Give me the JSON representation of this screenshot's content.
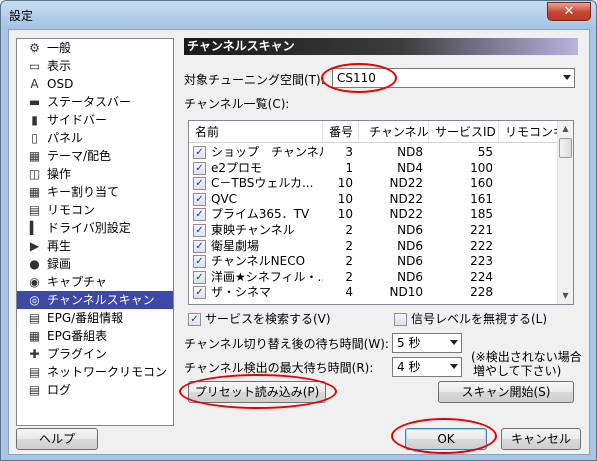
{
  "window": {
    "title": "設定",
    "close_glyph": "✕"
  },
  "sidebar": {
    "items": [
      {
        "label": "一般",
        "icon": "gear-icon",
        "glyph": "⚙"
      },
      {
        "label": "表示",
        "icon": "display-icon",
        "glyph": "▭"
      },
      {
        "label": "OSD",
        "icon": "osd-icon",
        "glyph": "A"
      },
      {
        "label": "ステータスバー",
        "icon": "statusbar-icon",
        "glyph": "▬"
      },
      {
        "label": "サイドバー",
        "icon": "sidebar-icon",
        "glyph": "▮"
      },
      {
        "label": "パネル",
        "icon": "panel-icon",
        "glyph": "▯"
      },
      {
        "label": "テーマ/配色",
        "icon": "theme-icon",
        "glyph": "▦"
      },
      {
        "label": "操作",
        "icon": "mouse-icon",
        "glyph": "◫"
      },
      {
        "label": "キー割り当て",
        "icon": "keyboard-icon",
        "glyph": "▦"
      },
      {
        "label": "リモコン",
        "icon": "remote-icon",
        "glyph": "▤"
      },
      {
        "label": "ドライバ別設定",
        "icon": "driver-icon",
        "glyph": "▍"
      },
      {
        "label": "再生",
        "icon": "play-icon",
        "glyph": "▶"
      },
      {
        "label": "録画",
        "icon": "record-icon",
        "glyph": "●"
      },
      {
        "label": "キャプチャ",
        "icon": "camera-icon",
        "glyph": "◉"
      },
      {
        "label": "チャンネルスキャン",
        "icon": "scan-icon",
        "glyph": "◎"
      },
      {
        "label": "EPG/番組情報",
        "icon": "epg-icon",
        "glyph": "▤"
      },
      {
        "label": "EPG番組表",
        "icon": "epg-table-icon",
        "glyph": "▦"
      },
      {
        "label": "プラグイン",
        "icon": "plugin-icon",
        "glyph": "✚"
      },
      {
        "label": "ネットワークリモコン",
        "icon": "network-remote-icon",
        "glyph": "▤"
      },
      {
        "label": "ログ",
        "icon": "log-icon",
        "glyph": "▤"
      }
    ],
    "selected_index": 14
  },
  "page": {
    "header": "チャンネルスキャン",
    "tuning_space_label": "対象チューニング空間(T):",
    "tuning_space_value": "CS110",
    "channel_list_label": "チャンネル一覧(C):",
    "columns": [
      "名前",
      "番号",
      "チャンネル",
      "サービスID",
      "リモコンキ"
    ],
    "rows": [
      {
        "name": "ショップ　チャンネル",
        "num": "3",
        "ch": "ND8",
        "sid": "55",
        "checked": true
      },
      {
        "name": "e2プロモ",
        "num": "1",
        "ch": "ND4",
        "sid": "100",
        "checked": true
      },
      {
        "name": "C－TBSウェルカ...",
        "num": "10",
        "ch": "ND22",
        "sid": "160",
        "checked": true
      },
      {
        "name": "QVC",
        "num": "10",
        "ch": "ND22",
        "sid": "161",
        "checked": true
      },
      {
        "name": "プライム365．TV",
        "num": "10",
        "ch": "ND22",
        "sid": "185",
        "checked": true
      },
      {
        "name": "東映チャンネル",
        "num": "2",
        "ch": "ND6",
        "sid": "221",
        "checked": true
      },
      {
        "name": "衛星劇場",
        "num": "2",
        "ch": "ND6",
        "sid": "222",
        "checked": true
      },
      {
        "name": "チャンネルNECO",
        "num": "2",
        "ch": "ND6",
        "sid": "223",
        "checked": true
      },
      {
        "name": "洋画★シネフィル・...",
        "num": "2",
        "ch": "ND6",
        "sid": "224",
        "checked": true
      },
      {
        "name": "ザ・シネマ",
        "num": "4",
        "ch": "ND10",
        "sid": "228",
        "checked": true
      }
    ],
    "search_services_label": "サービスを検索する(V)",
    "search_services_checked": true,
    "ignore_signal_label": "信号レベルを無視する(L)",
    "ignore_signal_checked": false,
    "switch_wait_label": "チャンネル切り替え後の待ち時間(W):",
    "switch_wait_value": "5 秒",
    "detect_wait_label": "チャンネル検出の最大待ち時間(R):",
    "detect_wait_value": "4 秒",
    "note_line1": "(※検出されない場合",
    "note_line2": "増やして下さい)",
    "preset_button": "プリセット読み込み(P)",
    "scan_button": "スキャン開始(S)"
  },
  "footer": {
    "help_button": "ヘルプ",
    "ok_button": "OK",
    "cancel_button": "キャンセル"
  },
  "colors": {
    "selection": "#3e49a7",
    "highlight_oval": "#e60000",
    "frame": "#a9c6e4"
  }
}
